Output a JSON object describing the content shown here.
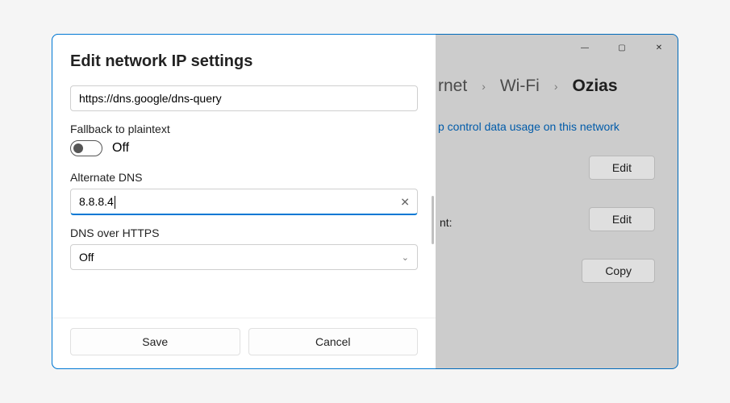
{
  "titlebar": {
    "min": "—",
    "max": "▢",
    "close": "✕"
  },
  "breadcrumb": {
    "a": "rnet",
    "b": "Wi-Fi",
    "c": "Ozias",
    "chev": "›"
  },
  "meta_link": "p control data usage on this network",
  "assign_label": "nt:",
  "right_buttons": {
    "edit1": "Edit",
    "edit2": "Edit",
    "copy": "Copy"
  },
  "modal": {
    "title": "Edit network IP settings",
    "doh_template": "https://dns.google/dns-query",
    "fallback_label": "Fallback to plaintext",
    "toggle_state": "Off",
    "alt_dns_label": "Alternate DNS",
    "alt_dns_value": "8.8.8.4",
    "doh_label": "DNS over HTTPS",
    "doh_value": "Off",
    "save": "Save",
    "cancel": "Cancel"
  }
}
